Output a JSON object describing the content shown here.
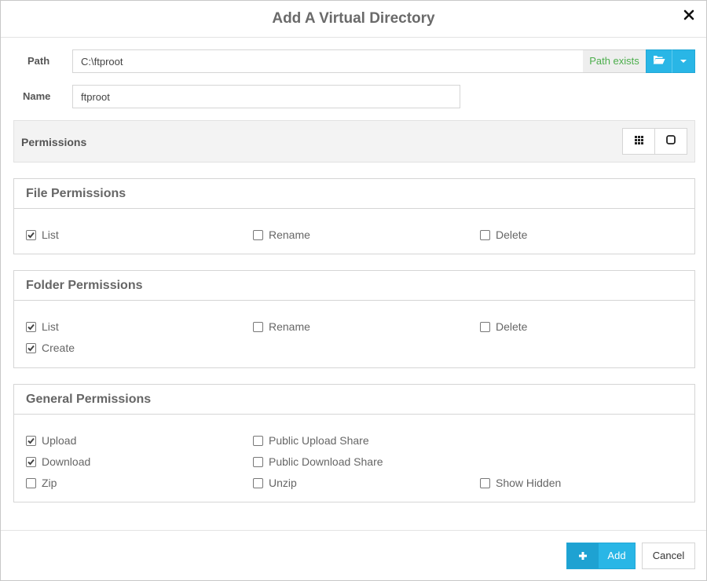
{
  "dialog": {
    "title": "Add A Virtual Directory",
    "close_icon": "close-icon"
  },
  "path": {
    "label": "Path",
    "value": "C:\\ftproot",
    "status": "Path exists",
    "status_color": "#4cae4c",
    "browse_icon": "folder-open-icon",
    "dropdown_icon": "caret-down-icon"
  },
  "name": {
    "label": "Name",
    "value": "ftproot"
  },
  "permissions": {
    "label": "Permissions",
    "view_icons": [
      "grid-icon",
      "square-icon"
    ]
  },
  "file_permissions": {
    "title": "File Permissions",
    "items": [
      {
        "label": "List",
        "checked": true
      },
      {
        "label": "Rename",
        "checked": false
      },
      {
        "label": "Delete",
        "checked": false
      }
    ]
  },
  "folder_permissions": {
    "title": "Folder Permissions",
    "items": [
      {
        "label": "List",
        "checked": true
      },
      {
        "label": "Rename",
        "checked": false
      },
      {
        "label": "Delete",
        "checked": false
      },
      {
        "label": "Create",
        "checked": true
      }
    ]
  },
  "general_permissions": {
    "title": "General Permissions",
    "items": [
      {
        "label": "Upload",
        "checked": true
      },
      {
        "label": "Public Upload Share",
        "checked": false
      },
      {
        "label": "Download",
        "checked": true
      },
      {
        "label": "Public Download Share",
        "checked": false
      },
      {
        "label": "Zip",
        "checked": false
      },
      {
        "label": "Unzip",
        "checked": false
      },
      {
        "label": "Show Hidden",
        "checked": false
      }
    ]
  },
  "footer": {
    "add_label": "Add",
    "add_icon": "plus-icon",
    "cancel_label": "Cancel",
    "accent_color": "#29b6e6"
  }
}
